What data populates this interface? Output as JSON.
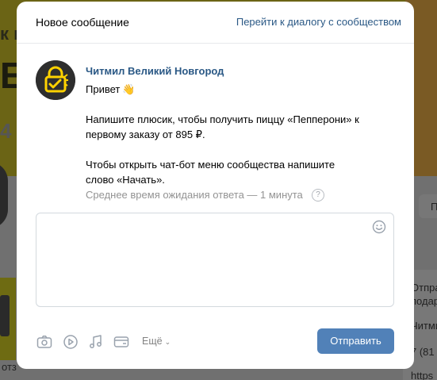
{
  "background": {
    "banner_text_1": "к п",
    "banner_text_2": "E",
    "banner_text_3": "4",
    "bottom_text": "отз",
    "right_texts": [
      "Отпра",
      "подар",
      "Читми",
      "7 (81",
      "https"
    ],
    "right_button": "П"
  },
  "modal": {
    "title": "Новое сообщение",
    "community_dialog_link": "Перейти к диалогу с сообществом"
  },
  "message": {
    "author": "Читмил Великий Новгород",
    "lines": {
      "greeting": "Привет",
      "promo_1": "Напишите плюсик, чтобы получить пиццу «Пепперони» к",
      "promo_2": "первому заказу от 895 ₽.",
      "bot_1": "Чтобы открыть чат-бот меню сообщества напишите",
      "bot_2": "слово «Начать»."
    },
    "waiting_time": "Среднее время ожидания ответа — 1 минута"
  },
  "composer": {
    "value": "",
    "placeholder": ""
  },
  "toolbar": {
    "icons": [
      "camera-icon",
      "video-icon",
      "music-icon",
      "card-icon"
    ],
    "more_label": "Ещё",
    "send_label": "Отправить"
  },
  "colors": {
    "accent": "#5181b8",
    "link": "#2a5885",
    "muted": "#939393",
    "brand_yellow": "#ffd200"
  }
}
